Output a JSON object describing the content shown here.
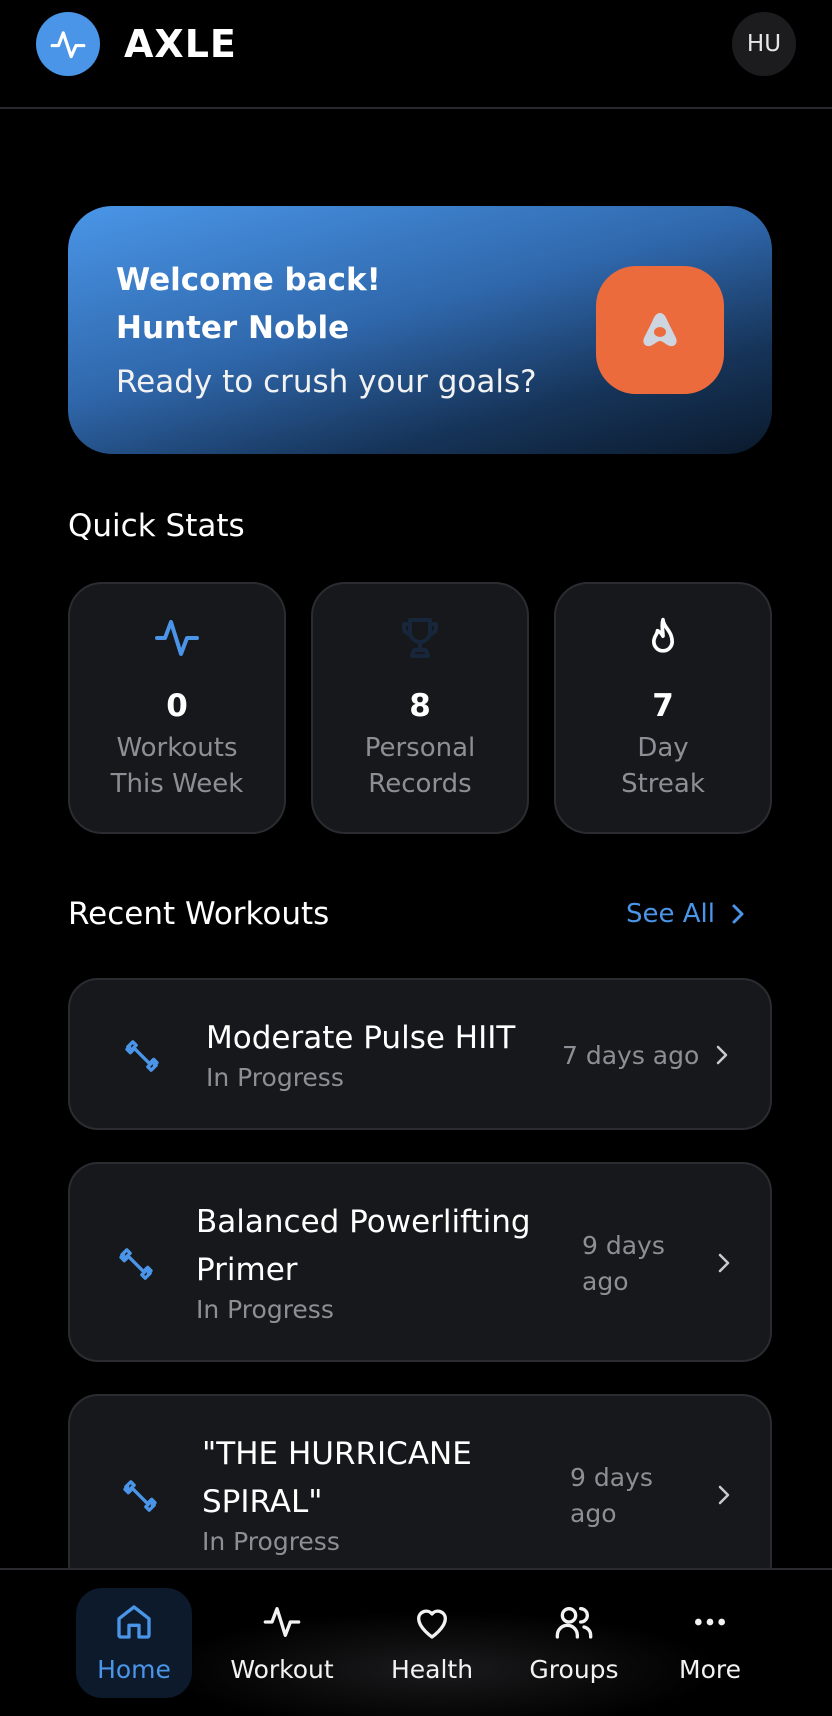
{
  "header": {
    "brand": "AXLE",
    "user_initials": "HU"
  },
  "hero": {
    "greeting": "Welcome back!",
    "name": "Hunter Noble",
    "subtitle": "Ready to crush your goals?"
  },
  "quick_stats": {
    "title": "Quick Stats",
    "items": [
      {
        "value": "0",
        "label_line1": "Workouts",
        "label_line2": "This Week",
        "icon": "activity-icon"
      },
      {
        "value": "8",
        "label_line1": "Personal",
        "label_line2": "Records",
        "icon": "trophy-icon"
      },
      {
        "value": "7",
        "label_line1": "Day",
        "label_line2": "Streak",
        "icon": "flame-icon"
      }
    ]
  },
  "recent_workouts": {
    "title": "Recent Workouts",
    "see_all": "See All",
    "items": [
      {
        "name_line1": "Moderate Pulse HIIT",
        "name_line2": "",
        "status": "In Progress",
        "time_line1": "7 days ago",
        "time_line2": ""
      },
      {
        "name_line1": "Balanced Powerlifting",
        "name_line2": "Primer",
        "status": "In Progress",
        "time_line1": "9 days",
        "time_line2": "ago"
      },
      {
        "name_line1": "\"THE HURRICANE",
        "name_line2": "SPIRAL\"",
        "status": "In Progress",
        "time_line1": "9 days",
        "time_line2": "ago"
      }
    ]
  },
  "nav": {
    "items": [
      {
        "label": "Home",
        "icon": "home-icon",
        "active": true
      },
      {
        "label": "Workout",
        "icon": "activity-icon",
        "active": false
      },
      {
        "label": "Health",
        "icon": "heart-icon",
        "active": false
      },
      {
        "label": "Groups",
        "icon": "users-icon",
        "active": false
      },
      {
        "label": "More",
        "icon": "more-icon",
        "active": false
      }
    ]
  },
  "colors": {
    "accent": "#4a95e8",
    "badge": "#ec6b3c",
    "card": "#17181b",
    "muted": "#8d8f96"
  }
}
